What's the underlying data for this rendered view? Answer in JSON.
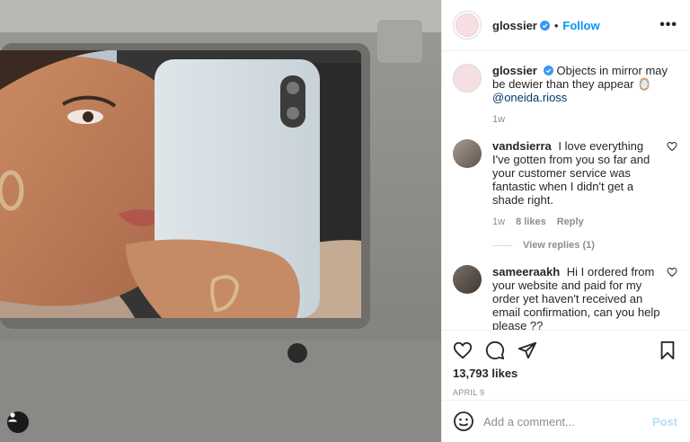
{
  "header": {
    "username": "glossier",
    "separator": "•",
    "follow_label": "Follow",
    "more_label": "•••"
  },
  "caption": {
    "username": "glossier",
    "text": "Objects in mirror may be dewier than they appear 🪞",
    "mention": "@oneida.rioss",
    "time": "1w"
  },
  "comments": [
    {
      "username": "vandsierra",
      "text": "I love everything I've gotten from you so far and your customer service was fantastic when I didn't get a shade right.",
      "time": "1w",
      "likes": "8 likes",
      "reply_label": "Reply",
      "view_replies": "View replies (1)"
    },
    {
      "username": "sameeraakh",
      "text": "Hi I ordered from your website and paid for my order yet haven't received an email confirmation, can you help please ??"
    }
  ],
  "likes_count": "13,793 likes",
  "post_date": "APRIL 9",
  "add_comment": {
    "placeholder": "Add a comment...",
    "post_label": "Post"
  },
  "colors": {
    "accent": "#0095f6",
    "post_disabled": "#b2dffc",
    "verified_badge": "#3897f0"
  },
  "icons": [
    "heart-icon",
    "comment-icon",
    "share-icon",
    "bookmark-icon",
    "emoji-icon",
    "user-tag-icon",
    "verified-icon",
    "heart-small-icon"
  ]
}
